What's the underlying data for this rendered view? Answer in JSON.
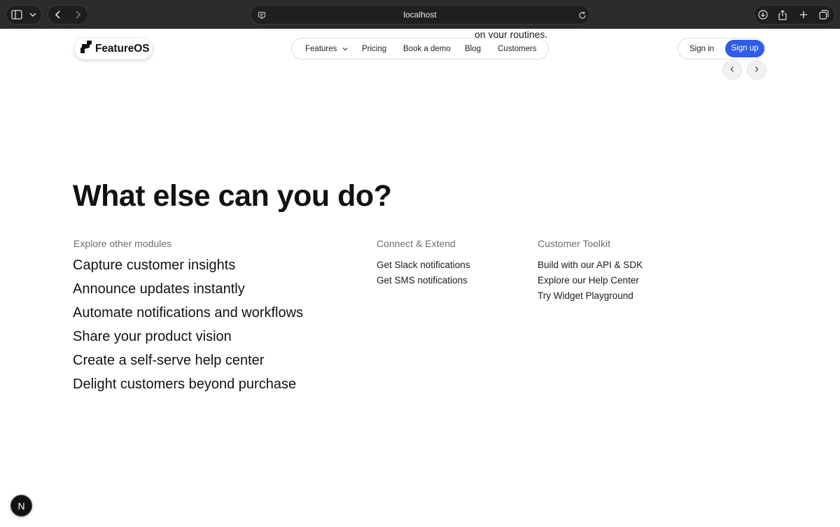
{
  "browser": {
    "address": "localhost",
    "icons": [
      "sidebar-icon",
      "chevron-down-icon",
      "back-icon",
      "forward-icon",
      "site-settings-icon",
      "reload-icon",
      "download-icon",
      "share-icon",
      "new-tab-icon",
      "tabs-overview-icon"
    ]
  },
  "page": {
    "peek_text": "on your routines."
  },
  "header": {
    "logo_text": "FeatureOS",
    "nav": {
      "features": "Features",
      "pricing": "Pricing",
      "book_demo": "Book a demo",
      "blog": "Blog",
      "customers": "Customers"
    },
    "sign_in": "Sign in",
    "sign_up": "Sign up",
    "sign_up_color": "#2f5ce6"
  },
  "section": {
    "heading": "What else can you do?",
    "modules": {
      "title": "Explore other modules",
      "items": [
        "Capture customer insights",
        "Announce updates instantly",
        "Automate notifications and workflows",
        "Share your product vision",
        "Create a self-serve help center",
        "Delight customers beyond purchase"
      ]
    },
    "connect": {
      "title": "Connect & Extend",
      "items": [
        "Get Slack notifications",
        "Get SMS notifications"
      ]
    },
    "toolkit": {
      "title": "Customer Toolkit",
      "items": [
        "Build with our API & SDK",
        "Explore our Help Center",
        "Try Widget Playground"
      ]
    }
  },
  "badge": {
    "letter": "N"
  }
}
